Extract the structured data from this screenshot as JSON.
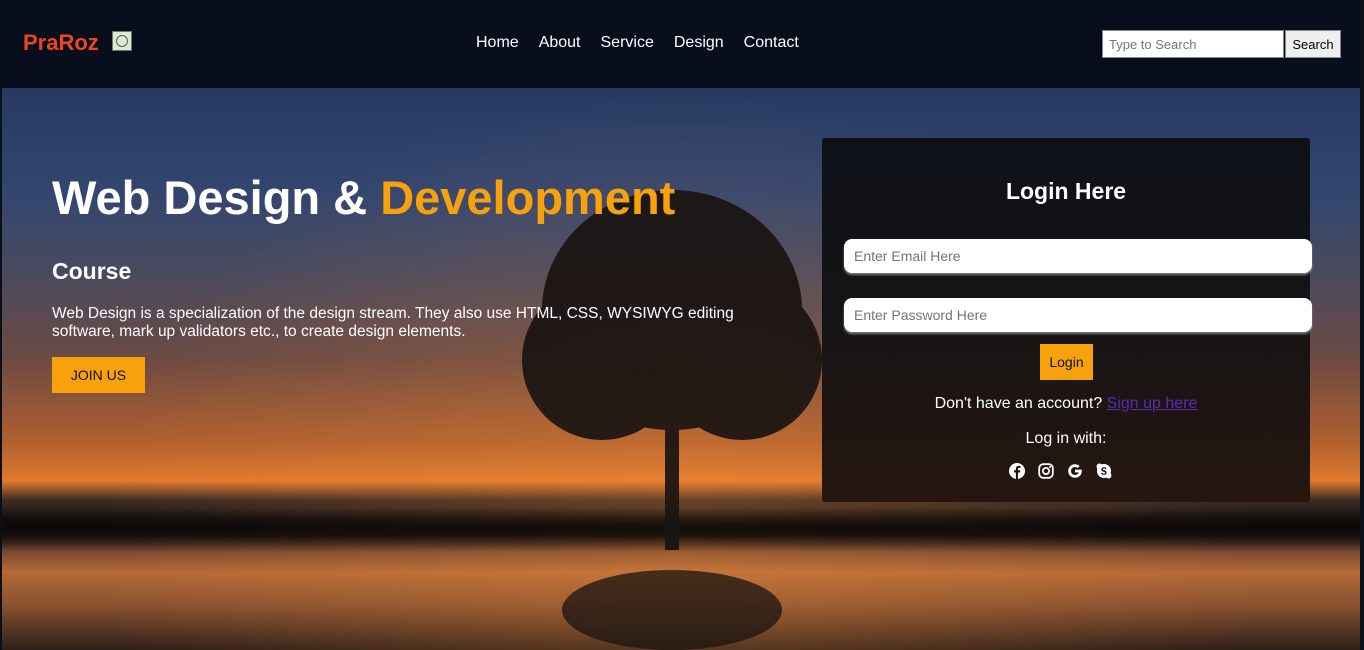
{
  "header": {
    "brand": "PraRoz",
    "logo_icon": "brand-emblem-icon",
    "nav": [
      "Home",
      "About",
      "Service",
      "Design",
      "Contact"
    ],
    "search": {
      "placeholder": "Type to Search",
      "button": "Search"
    }
  },
  "hero": {
    "title_part1": "Web Design & ",
    "title_accent": "Development",
    "subtitle": "Course",
    "text": "Web Design is a specialization of the design stream. They also use HTML, CSS, WYSIWYG editing software, mark up validators etc., to create design elements.",
    "join_button": "JOIN US"
  },
  "login": {
    "title": "Login Here",
    "email_placeholder": "Enter Email Here",
    "password_placeholder": "Enter Password Here",
    "button": "Login",
    "no_account": "Don't have an account?",
    "signup_link": "Sign up here",
    "login_with": "Log in with:",
    "socials": [
      "facebook-icon",
      "instagram-icon",
      "google-icon",
      "skype-icon"
    ]
  },
  "colors": {
    "accent": "#f7a10d",
    "brand": "#f0451c",
    "header_bg": "#090e1c",
    "link": "#5a2bb0"
  }
}
